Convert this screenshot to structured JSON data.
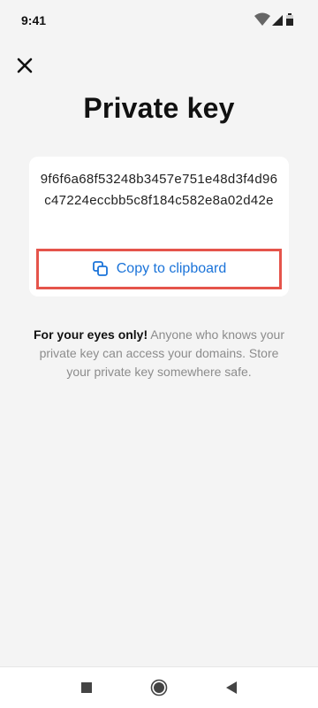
{
  "status_bar": {
    "time": "9:41",
    "icons": [
      "wifi-icon",
      "signal-icon",
      "battery-icon"
    ]
  },
  "header": {
    "close_icon": "close-icon"
  },
  "page": {
    "title": "Private key"
  },
  "key_card": {
    "private_key": "9f6f6a68f53248b3457e751e48d3f4d96c47224eccbb5c8f184c582e8a02d42e",
    "copy_label": "Copy to clipboard",
    "copy_icon": "copy-icon"
  },
  "info": {
    "emphasis": "For your eyes only!",
    "message": " Anyone who knows your private key can access your domains. Store your private key somewhere safe."
  },
  "nav_bar": {
    "icons": [
      "recents-icon",
      "home-icon",
      "back-icon"
    ]
  },
  "colors": {
    "background": "#f4f4f4",
    "accent": "#1a73d9",
    "highlight_border": "#e5544b"
  }
}
